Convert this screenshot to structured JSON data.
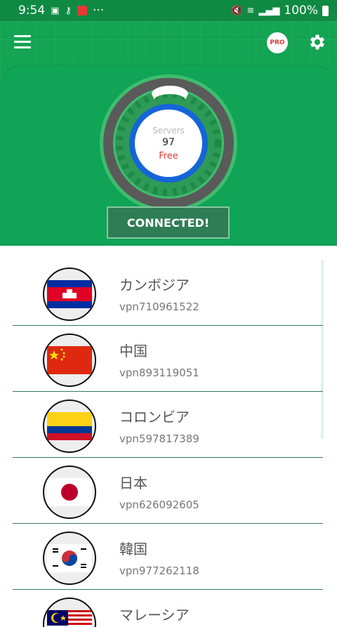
{
  "status_bar": {
    "time": "9:54",
    "battery": "100%",
    "dots": "···"
  },
  "header": {
    "pro_label": "PRO"
  },
  "gauge": {
    "label": "Servers",
    "count": "97",
    "tier": "Free"
  },
  "connect_button": {
    "label": "CONNECTED!"
  },
  "servers": [
    {
      "country": "カンボジア",
      "id": "vpn710961522",
      "flag": "cambodia"
    },
    {
      "country": "中国",
      "id": "vpn893119051",
      "flag": "china"
    },
    {
      "country": "コロンビア",
      "id": "vpn597817389",
      "flag": "colombia"
    },
    {
      "country": "日本",
      "id": "vpn626092605",
      "flag": "japan"
    },
    {
      "country": "韓国",
      "id": "vpn977262118",
      "flag": "korea"
    },
    {
      "country": "マレーシア",
      "id": "",
      "flag": "malaysia"
    }
  ],
  "colors": {
    "brand_green": "#14a453",
    "status_green": "#0f8a43",
    "accent_red": "#e53935",
    "divider": "#2e7d55"
  }
}
